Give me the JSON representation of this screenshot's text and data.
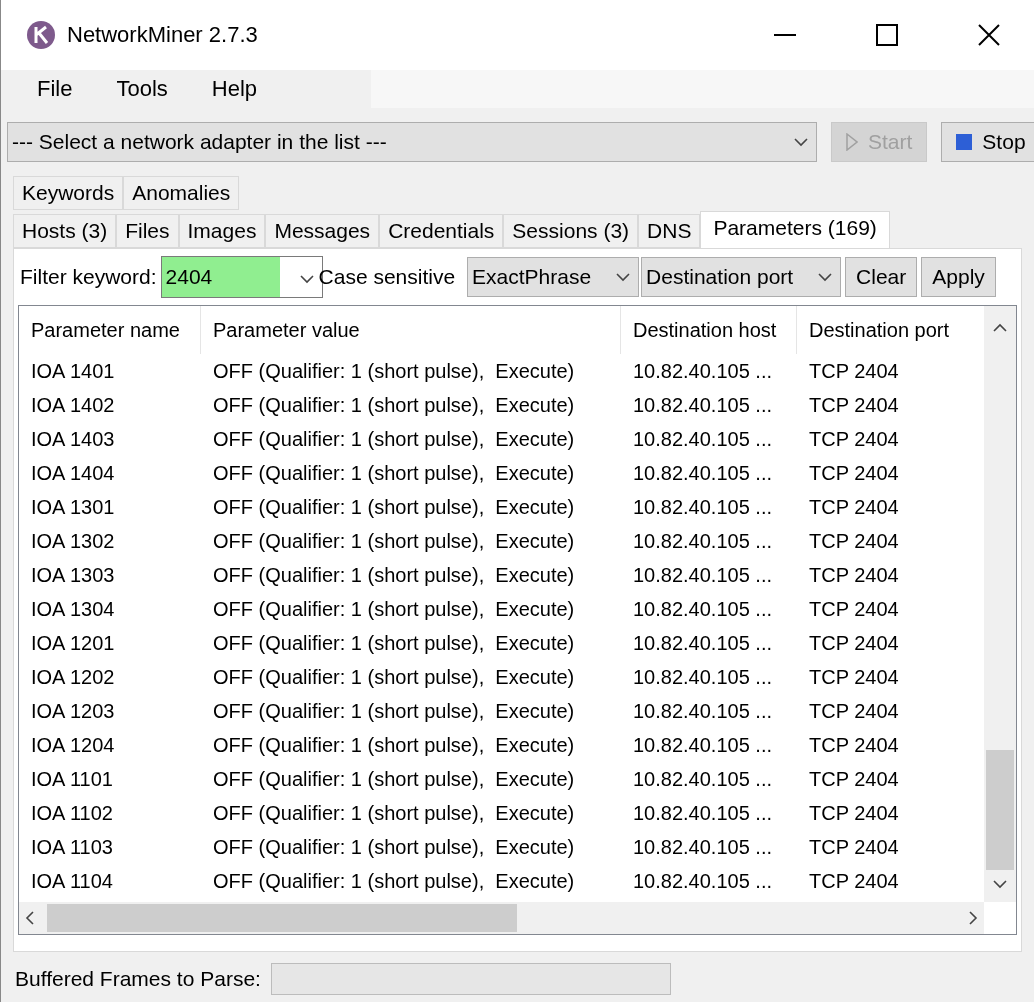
{
  "window": {
    "title": "NetworkMiner 2.7.3"
  },
  "menu": [
    "File",
    "Tools",
    "Help"
  ],
  "adapter": {
    "value": "--- Select a network adapter in the list ---",
    "start": {
      "label": "Start",
      "disabled": true
    },
    "stop": {
      "label": "Stop",
      "disabled": false
    }
  },
  "tab_rows": [
    [
      {
        "label": "Keywords",
        "selected": false
      },
      {
        "label": "Anomalies",
        "selected": false
      }
    ],
    [
      {
        "label": "Hosts (3)",
        "selected": false
      },
      {
        "label": "Files",
        "selected": false
      },
      {
        "label": "Images",
        "selected": false
      },
      {
        "label": "Messages",
        "selected": false
      },
      {
        "label": "Credentials",
        "selected": false
      },
      {
        "label": "Sessions (3)",
        "selected": false
      },
      {
        "label": "DNS",
        "selected": false
      },
      {
        "label": "Parameters (169)",
        "selected": true
      }
    ]
  ],
  "filter": {
    "label": "Filter keyword:",
    "value": "2404",
    "case_sensitive_label": "Case sensitive",
    "mode": "ExactPhrase",
    "column": "Destination port",
    "buttons": [
      "Clear",
      "Apply"
    ]
  },
  "table": {
    "columns": [
      "Parameter name",
      "Parameter value",
      "Destination host",
      "Destination port"
    ],
    "rows": [
      [
        "IOA 1401",
        "OFF (Qualifier: 1 (short pulse),  Execute)",
        "10.82.40.105 ...",
        "TCP 2404"
      ],
      [
        "IOA 1402",
        "OFF (Qualifier: 1 (short pulse),  Execute)",
        "10.82.40.105 ...",
        "TCP 2404"
      ],
      [
        "IOA 1403",
        "OFF (Qualifier: 1 (short pulse),  Execute)",
        "10.82.40.105 ...",
        "TCP 2404"
      ],
      [
        "IOA 1404",
        "OFF (Qualifier: 1 (short pulse),  Execute)",
        "10.82.40.105 ...",
        "TCP 2404"
      ],
      [
        "IOA 1301",
        "OFF (Qualifier: 1 (short pulse),  Execute)",
        "10.82.40.105 ...",
        "TCP 2404"
      ],
      [
        "IOA 1302",
        "OFF (Qualifier: 1 (short pulse),  Execute)",
        "10.82.40.105 ...",
        "TCP 2404"
      ],
      [
        "IOA 1303",
        "OFF (Qualifier: 1 (short pulse),  Execute)",
        "10.82.40.105 ...",
        "TCP 2404"
      ],
      [
        "IOA 1304",
        "OFF (Qualifier: 1 (short pulse),  Execute)",
        "10.82.40.105 ...",
        "TCP 2404"
      ],
      [
        "IOA 1201",
        "OFF (Qualifier: 1 (short pulse),  Execute)",
        "10.82.40.105 ...",
        "TCP 2404"
      ],
      [
        "IOA 1202",
        "OFF (Qualifier: 1 (short pulse),  Execute)",
        "10.82.40.105 ...",
        "TCP 2404"
      ],
      [
        "IOA 1203",
        "OFF (Qualifier: 1 (short pulse),  Execute)",
        "10.82.40.105 ...",
        "TCP 2404"
      ],
      [
        "IOA 1204",
        "OFF (Qualifier: 1 (short pulse),  Execute)",
        "10.82.40.105 ...",
        "TCP 2404"
      ],
      [
        "IOA 1101",
        "OFF (Qualifier: 1 (short pulse),  Execute)",
        "10.82.40.105 ...",
        "TCP 2404"
      ],
      [
        "IOA 1102",
        "OFF (Qualifier: 1 (short pulse),  Execute)",
        "10.82.40.105 ...",
        "TCP 2404"
      ],
      [
        "IOA 1103",
        "OFF (Qualifier: 1 (short pulse),  Execute)",
        "10.82.40.105 ...",
        "TCP 2404"
      ],
      [
        "IOA 1104",
        "OFF (Qualifier: 1 (short pulse),  Execute)",
        "10.82.40.105 ...",
        "TCP 2404"
      ]
    ]
  },
  "status_bar": {
    "label": "Buffered Frames to Parse:",
    "level": 0
  }
}
